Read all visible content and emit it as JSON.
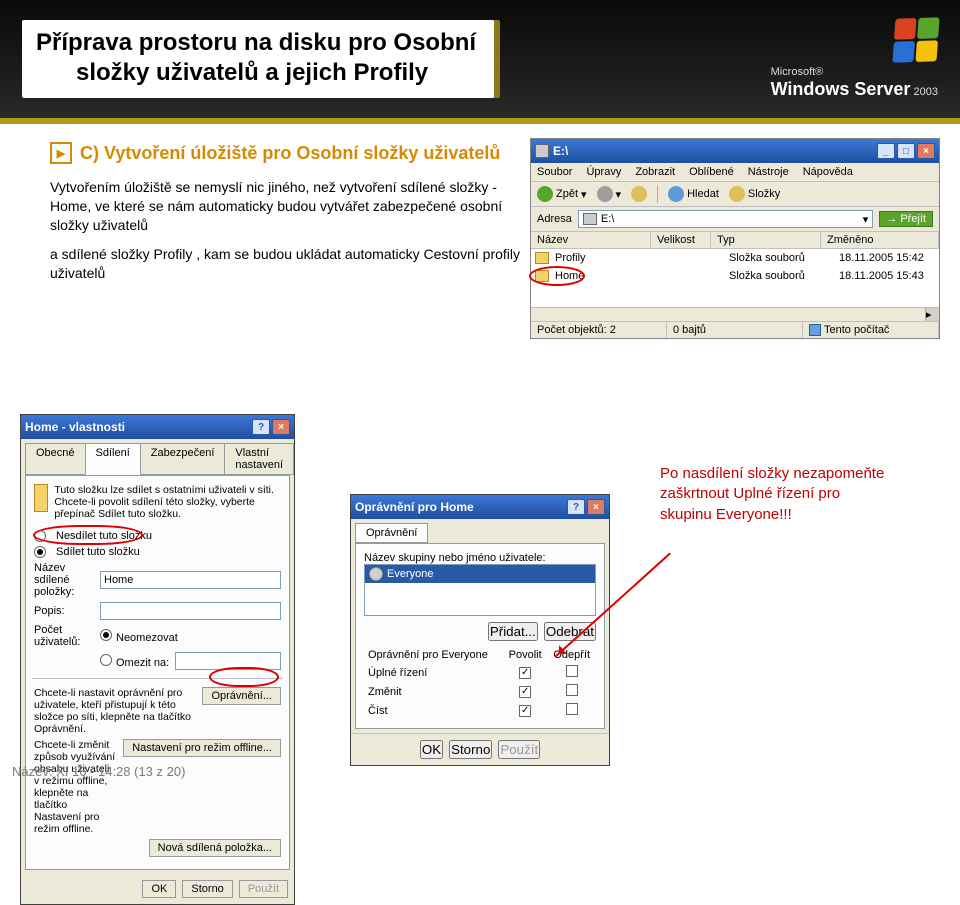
{
  "header": {
    "title_line1": "Příprava prostoru na disku pro Osobní",
    "title_line2": "složky uživatelů a jejich Profily",
    "brand_small": "Microsoft®",
    "brand_big": "Windows Server",
    "brand_year": "2003"
  },
  "section": {
    "letter": "C)",
    "heading": "Vytvoření úložiště  pro Osobní složky uživatelů"
  },
  "body": {
    "p1": "Vytvořením úložiště se nemyslí nic jiného, než vytvoření sdílené složky - Home,  ve které se nám automaticky budou vytvářet zabezpečené osobní složky uživatelů",
    "p2": "a sdílené složky Profily , kam se budou ukládat automaticky  Cestovní profily uživatelů"
  },
  "callout": {
    "l1": "Po nasdílení složky nezapomeňte",
    "l2": "zaškrtnout Uplné řízení  pro",
    "l3": "skupinu Everyone!!!"
  },
  "explorer": {
    "title": "E:\\",
    "menu": [
      "Soubor",
      "Úpravy",
      "Zobrazit",
      "Oblíbené",
      "Nástroje",
      "Nápověda"
    ],
    "toolbar": {
      "back": "Zpět",
      "search": "Hledat",
      "folders": "Složky"
    },
    "addr_label": "Adresa",
    "addr_value": "E:\\",
    "go": "Přejít",
    "cols": {
      "name": "Název",
      "size": "Velikost",
      "type": "Typ",
      "mod": "Změněno"
    },
    "rows": [
      {
        "name": "Profily",
        "type": "Složka souborů",
        "mod": "18.11.2005 15:42"
      },
      {
        "name": "Home",
        "type": "Složka souborů",
        "mod": "18.11.2005 15:43"
      }
    ],
    "status": {
      "count": "Počet objektů: 2",
      "bytes": "0 bajtů",
      "loc": "Tento počítač"
    }
  },
  "props": {
    "title": "Home - vlastnosti",
    "tabs": [
      "Obecné",
      "Sdílení",
      "Zabezpečení",
      "Vlastní nastavení"
    ],
    "intro": "Tuto složku lze sdílet s ostatními uživateli v síti. Chcete-li povolit sdílení této složky, vyberte přepínač Sdílet tuto složku.",
    "opt_noshare": "Nesdílet tuto složku",
    "opt_share": "Sdílet tuto složku",
    "name_lbl": "Název sdílené položky:",
    "name_val": "Home",
    "desc_lbl": "Popis:",
    "limit_lbl": "Počet uživatelů:",
    "opt_unlim": "Neomezovat",
    "opt_lim": "Omezit na:",
    "perm_text": "Chcete-li nastavit oprávnění pro uživatele, kteří přistupují k této složce po síti, klepněte na tlačítko Oprávnění.",
    "perm_btn": "Oprávnění...",
    "offline_text": "Chcete-li změnit způsob využívání obsahu uživateli v režimu offline, klepněte na tlačítko Nastavení pro režim offline.",
    "offline_btn": "Nastavení pro režim offline...",
    "new_share": "Nová sdílená položka...",
    "ok": "OK",
    "cancel": "Storno",
    "apply": "Použít"
  },
  "perm": {
    "title": "Oprávnění pro Home",
    "tab": "Oprávnění",
    "list_lbl": "Název skupiny nebo jméno uživatele:",
    "everyone": "Everyone",
    "add": "Přidat...",
    "remove": "Odebrat",
    "hdr": "Oprávnění pro Everyone",
    "allow": "Povolit",
    "deny": "Odepřít",
    "rows": [
      {
        "label": "Úplné řízení",
        "allow": true,
        "deny": false
      },
      {
        "label": "Změnit",
        "allow": true,
        "deny": false
      },
      {
        "label": "Číst",
        "allow": true,
        "deny": false
      }
    ],
    "ok": "OK",
    "cancel": "Storno",
    "apply": "Použít"
  },
  "footer": "Název: XI 16 - 14:28 (13 z 20)"
}
